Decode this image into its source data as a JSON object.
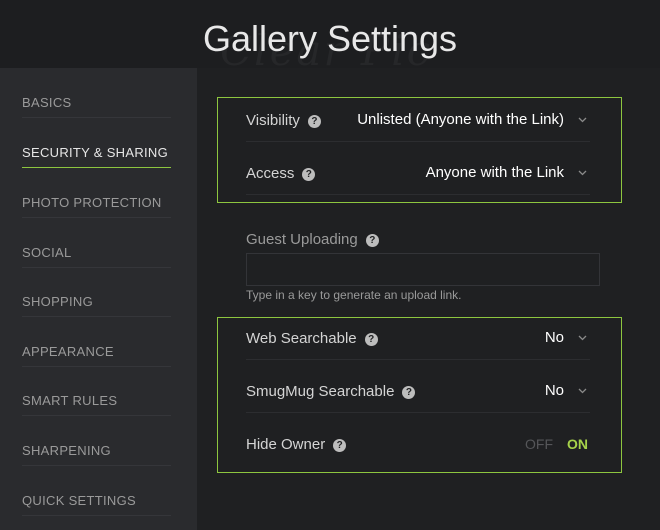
{
  "header": {
    "title": "Gallery Settings",
    "bg_text": "Clear Pic"
  },
  "sidebar": {
    "items": [
      {
        "label": "BASICS"
      },
      {
        "label": "SECURITY & SHARING",
        "active": true
      },
      {
        "label": "PHOTO PROTECTION"
      },
      {
        "label": "SOCIAL"
      },
      {
        "label": "SHOPPING"
      },
      {
        "label": "APPEARANCE"
      },
      {
        "label": "SMART RULES"
      },
      {
        "label": "SHARPENING"
      },
      {
        "label": "QUICK SETTINGS"
      }
    ]
  },
  "settings": {
    "visibility": {
      "label": "Visibility",
      "value": "Unlisted (Anyone with the Link)"
    },
    "access": {
      "label": "Access",
      "value": "Anyone with the Link"
    },
    "guest_uploading": {
      "label": "Guest Uploading",
      "value": "",
      "hint": "Type in a key to generate an upload link."
    },
    "web_searchable": {
      "label": "Web Searchable",
      "value": "No"
    },
    "smugmug_searchable": {
      "label": "SmugMug Searchable",
      "value": "No"
    },
    "hide_owner": {
      "label": "Hide Owner",
      "off_label": "OFF",
      "on_label": "ON",
      "state": "on"
    }
  },
  "icons": {
    "help": "help-icon",
    "dropdown": "chevron-down-icon"
  },
  "colors": {
    "accent": "#8dc63f",
    "on": "#a6d24a",
    "background": "#1d1e20",
    "sidebar": "#2a2b2e"
  }
}
